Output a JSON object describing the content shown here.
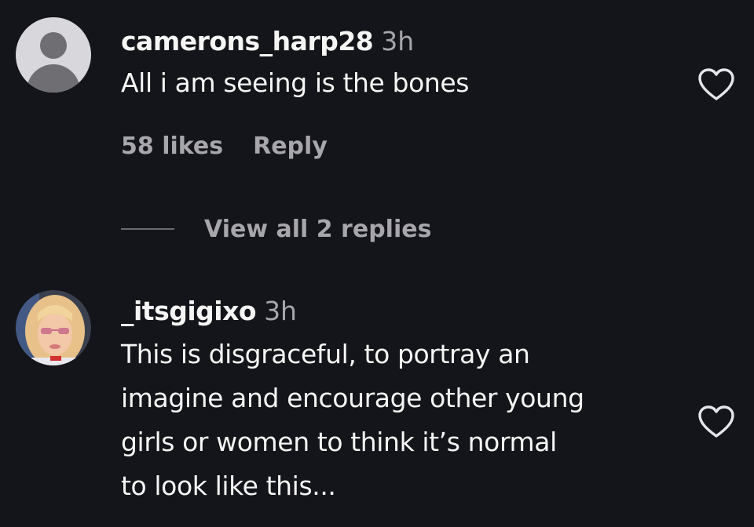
{
  "comments": [
    {
      "username": "camerons_harp28",
      "time": "3h",
      "text": "All i am seeing is the bones",
      "likes": "58 likes",
      "reply_label": "Reply",
      "view_replies": "View all 2 replies"
    },
    {
      "username": "_itsgigixo",
      "time": "3h",
      "text_lines": [
        "This is disgraceful, to portray an",
        "imagine and encourage other young",
        "girls or women to think it’s normal",
        "to look like this..."
      ]
    }
  ],
  "colors": {
    "background": "#14151a",
    "primary_text": "#f5f5f5",
    "secondary_text": "#a6a6ab"
  },
  "icons": {
    "like": "heart-outline-icon",
    "default_avatar": "default-user-avatar"
  }
}
